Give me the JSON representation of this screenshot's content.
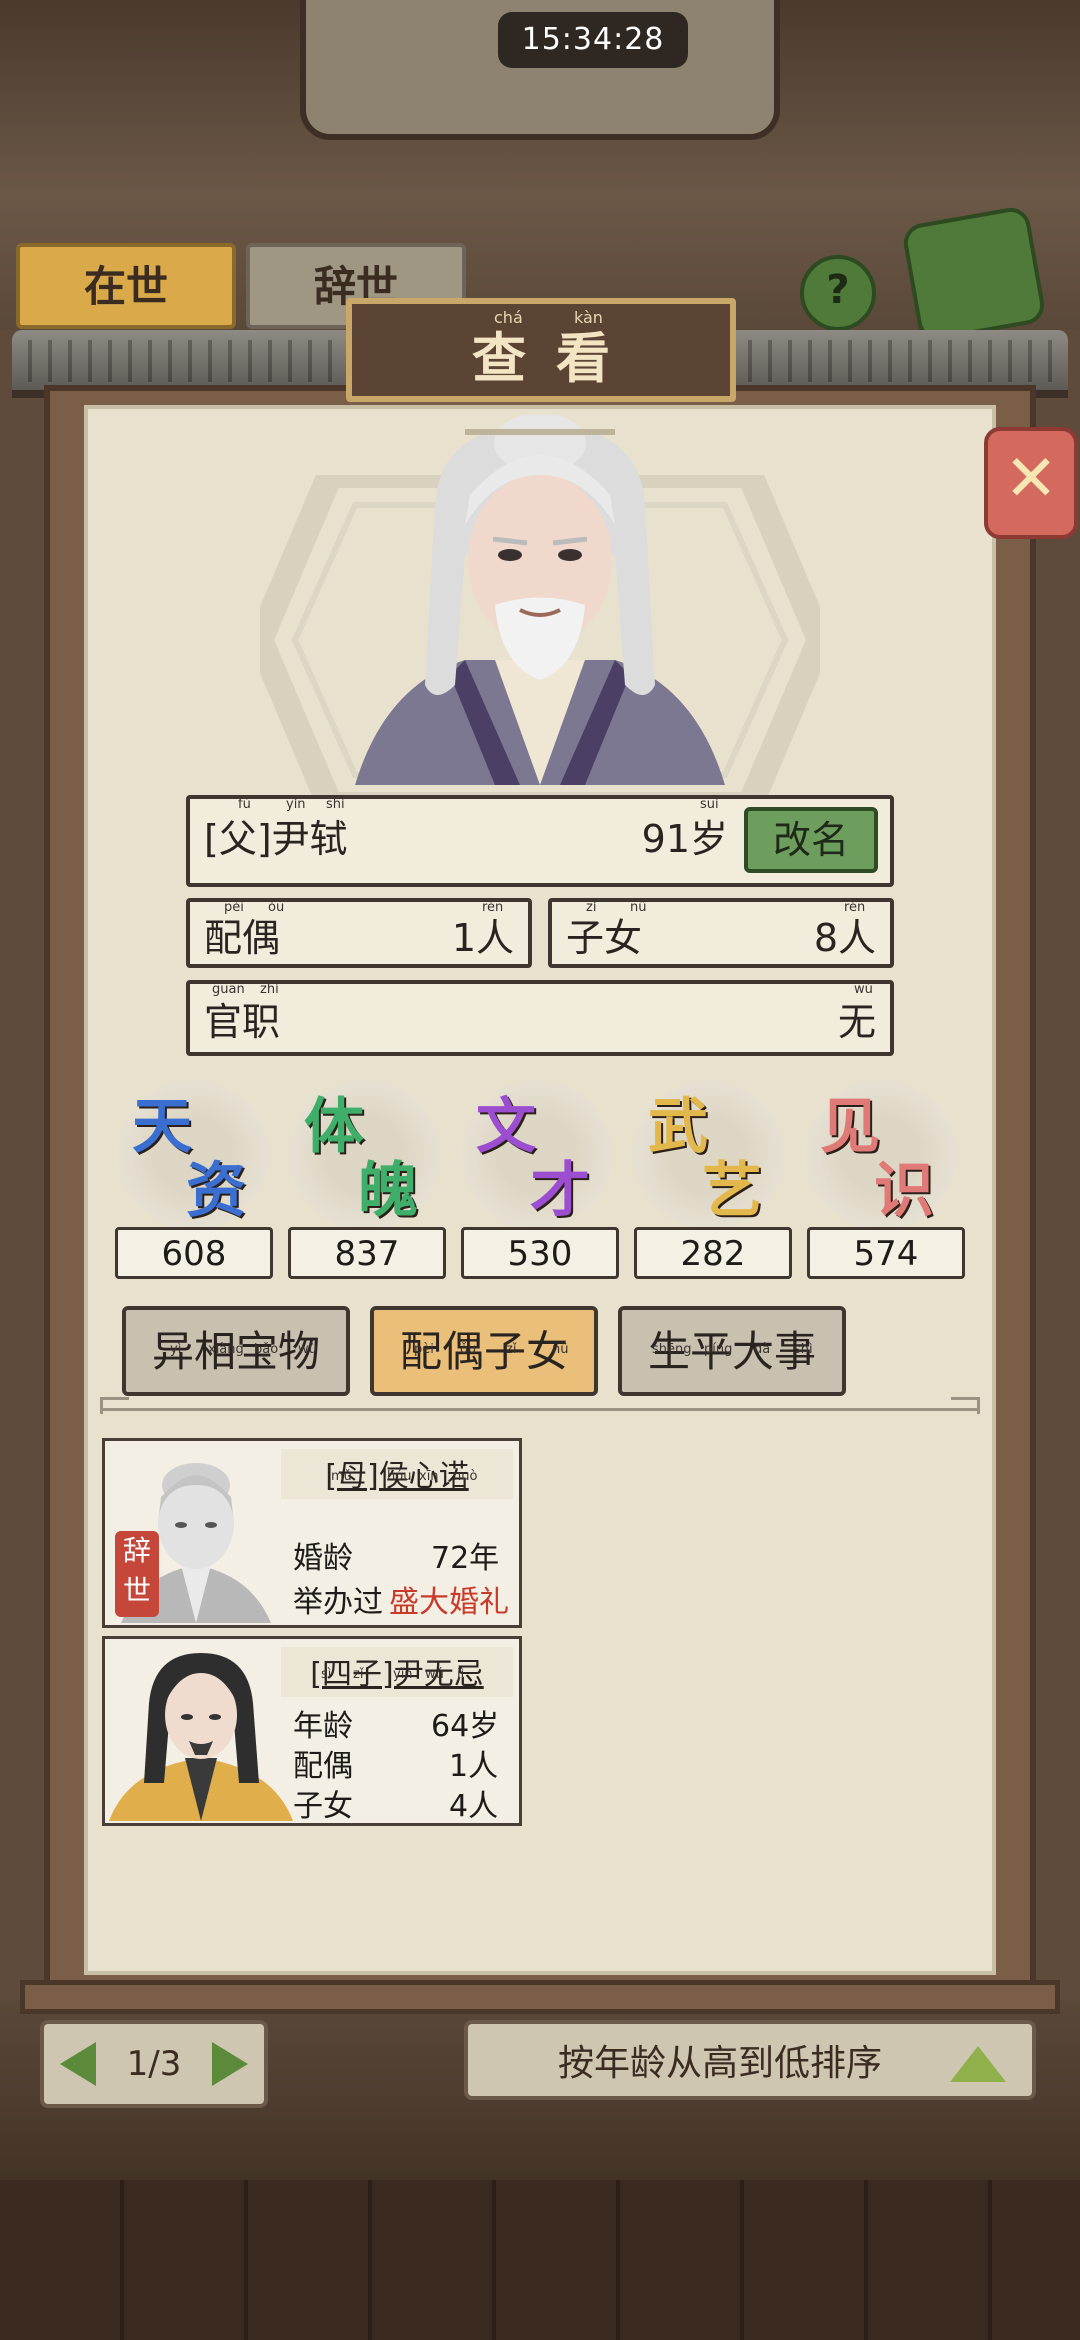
{
  "status_bar": {
    "time": "15:34:28"
  },
  "background": {
    "tabs": [
      "在世",
      "辞世"
    ],
    "help": "?",
    "pager": "1/3",
    "sort_label": "按年龄从高到低排序"
  },
  "dialog": {
    "title": "查看",
    "title_pinyin": [
      "chá",
      "kàn"
    ],
    "close_icon": "close-x-icon"
  },
  "person": {
    "name": "[父]尹轼",
    "name_pinyin": [
      "fù",
      "yǐn",
      "shì"
    ],
    "age": "91岁",
    "age_pinyin": "suì",
    "rename_label": "改名",
    "spouse_label": "配偶",
    "spouse_pinyin": [
      "pèi",
      "ǒu"
    ],
    "spouse_value": "1人",
    "children_label": "子女",
    "children_pinyin": [
      "zǐ",
      "nǚ"
    ],
    "children_value": "8人",
    "rank_pinyin": "rén",
    "post_label": "官职",
    "post_pinyin": [
      "guān",
      "zhí"
    ],
    "post_value": "无",
    "post_value_pinyin": "wú"
  },
  "stats": [
    {
      "c1": "天",
      "c2": "资",
      "value": "608",
      "color": "#3a6fd1"
    },
    {
      "c1": "体",
      "c2": "魄",
      "value": "837",
      "color": "#3fae6a"
    },
    {
      "c1": "文",
      "c2": "才",
      "value": "530",
      "color": "#9b4fd0"
    },
    {
      "c1": "武",
      "c2": "艺",
      "value": "282",
      "color": "#e2b84c"
    },
    {
      "c1": "见",
      "c2": "识",
      "value": "574",
      "color": "#e07a78"
    }
  ],
  "tabs": [
    {
      "label": "异相宝物",
      "pinyin": [
        "yì",
        "xiàng",
        "bǎo",
        "wù"
      ],
      "active": false
    },
    {
      "label": "配偶子女",
      "pinyin": [
        "pèi",
        "ǒu",
        "zǐ",
        "nǚ"
      ],
      "active": true
    },
    {
      "label": "生平大事",
      "pinyin": [
        "shēng",
        "píng",
        "dà",
        "shì"
      ],
      "active": false
    }
  ],
  "relatives": [
    {
      "title": "[母]侯心诺",
      "title_pinyin": [
        "mǔ",
        "hóu",
        "xīn",
        "nuò"
      ],
      "seal": [
        "辞",
        "世"
      ],
      "rows": [
        {
          "label": "婚龄",
          "value": "72年"
        },
        {
          "label": "举办过",
          "value": "盛大婚礼"
        }
      ]
    },
    {
      "title": "[四子]尹无忌",
      "title_pinyin": [
        "sì",
        "zǐ",
        "yǐn",
        "wú",
        "jì"
      ],
      "rows": [
        {
          "label": "年龄",
          "value": "64岁"
        },
        {
          "label": "配偶",
          "value": "1人"
        },
        {
          "label": "子女",
          "value": "4人"
        }
      ]
    }
  ]
}
